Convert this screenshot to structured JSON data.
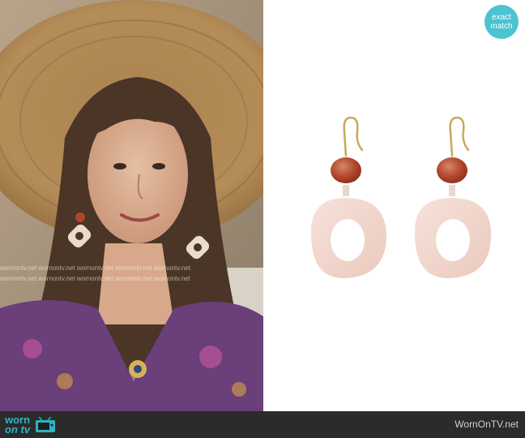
{
  "badge": {
    "line1": "exact",
    "line2": "match"
  },
  "watermark": {
    "rows": [
      "wornontv.net  wornontv.net  wornontv.net  wornontv.net  wornontv.net",
      "wornontv.net  wornontv.net  wornontv.net  wornontv.net  wornontv.net"
    ]
  },
  "footer": {
    "logo_top": "worn",
    "logo_bottom": "on tv",
    "site": "WornOnTV.net"
  },
  "colors": {
    "accent": "#4cc3d0",
    "footer_bg": "#2b2b2b"
  }
}
